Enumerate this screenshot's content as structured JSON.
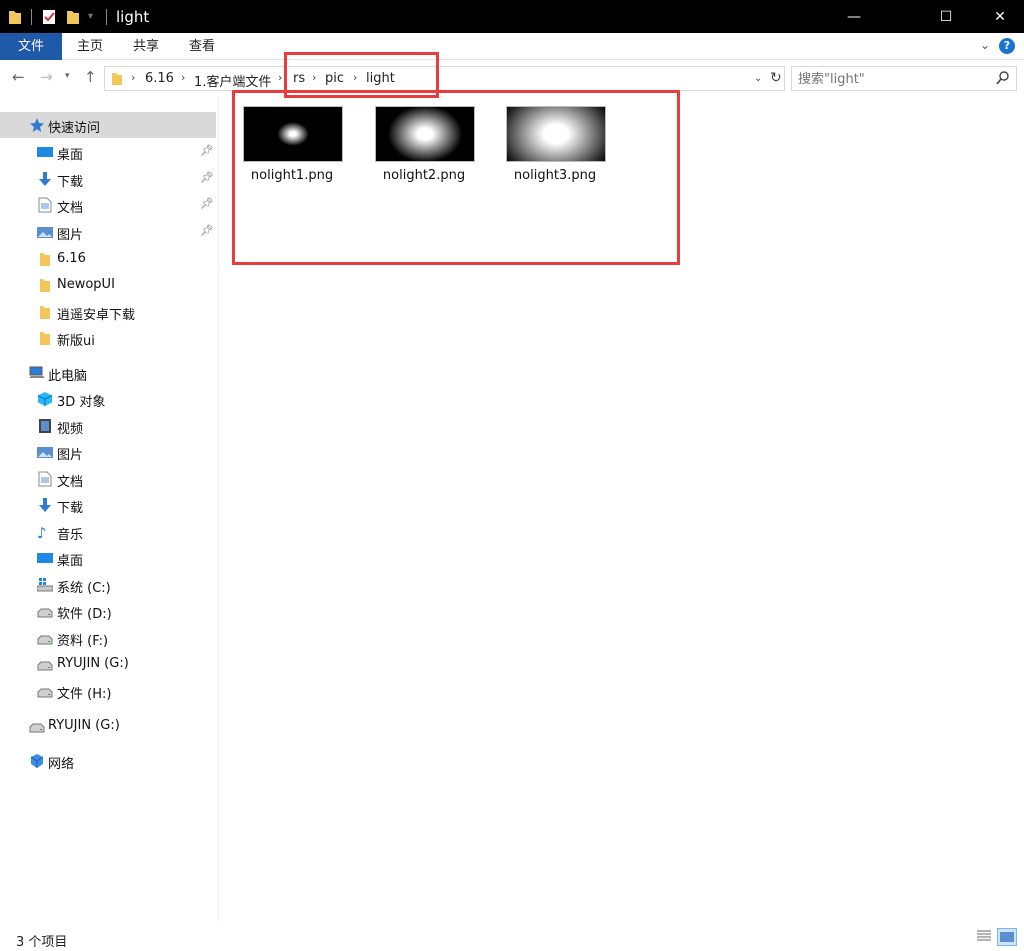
{
  "window": {
    "title": "light",
    "minimize": "—",
    "maximize": "☐",
    "close": "✕"
  },
  "ribbon": {
    "tabs": [
      "文件",
      "主页",
      "共享",
      "查看"
    ],
    "help": "?"
  },
  "address": {
    "crumbs": [
      "6.16",
      "1.客户端文件",
      "rs",
      "pic",
      "light"
    ],
    "search_placeholder": "搜索\"light\""
  },
  "navigation": {
    "quick_access": "快速访问",
    "quick_items": [
      {
        "label": "桌面",
        "icon": "desktop-icon",
        "pinned": true
      },
      {
        "label": "下载",
        "icon": "download-icon",
        "pinned": true
      },
      {
        "label": "文档",
        "icon": "document-icon",
        "pinned": true
      },
      {
        "label": "图片",
        "icon": "pictures-icon",
        "pinned": true
      },
      {
        "label": "6.16",
        "icon": "folder-icon",
        "pinned": false
      },
      {
        "label": "NewopUI",
        "icon": "folder-icon",
        "pinned": false
      },
      {
        "label": "逍遥安卓下载",
        "icon": "folder-icon",
        "pinned": false
      },
      {
        "label": "新版ui",
        "icon": "folder-icon",
        "pinned": false
      }
    ],
    "this_pc": "此电脑",
    "pc_items": [
      {
        "label": "3D 对象",
        "icon": "3d-objects-icon"
      },
      {
        "label": "视频",
        "icon": "videos-icon"
      },
      {
        "label": "图片",
        "icon": "pictures-icon"
      },
      {
        "label": "文档",
        "icon": "document-icon"
      },
      {
        "label": "下载",
        "icon": "download-icon"
      },
      {
        "label": "音乐",
        "icon": "music-icon"
      },
      {
        "label": "桌面",
        "icon": "desktop-icon"
      },
      {
        "label": "系统 (C:)",
        "icon": "system-drive-icon"
      },
      {
        "label": "软件 (D:)",
        "icon": "drive-icon"
      },
      {
        "label": "资料 (F:)",
        "icon": "drive-icon"
      },
      {
        "label": "RYUJIN (G:)",
        "icon": "drive-icon"
      },
      {
        "label": "文件 (H:)",
        "icon": "drive-icon"
      }
    ],
    "removable": "RYUJIN (G:)",
    "network": "网络"
  },
  "files": [
    {
      "name": "nolight1.png",
      "glow": 0.16
    },
    {
      "name": "nolight2.png",
      "glow": 0.38
    },
    {
      "name": "nolight3.png",
      "glow": 0.62
    }
  ],
  "status": {
    "count": "3 个项目"
  },
  "colors": {
    "accent": "#1e5aa8",
    "highlight_box": "#ea3c3c",
    "selected_nav": "#d9d9d9"
  }
}
